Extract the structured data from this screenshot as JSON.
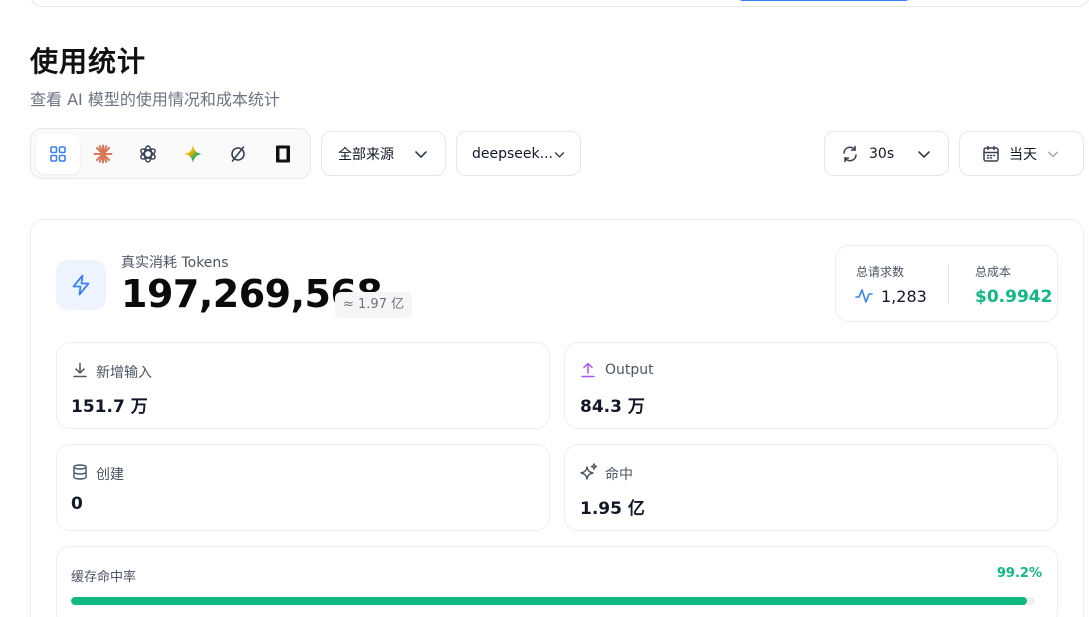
{
  "page": {
    "title": "使用统计",
    "subtitle": "查看 AI 模型的使用情况和成本统计"
  },
  "toolbar": {
    "providers": [
      {
        "icon": "grid-icon",
        "active": true
      },
      {
        "icon": "claude-icon",
        "active": false
      },
      {
        "icon": "openai-icon",
        "active": false
      },
      {
        "icon": "gemini-icon",
        "active": false
      },
      {
        "icon": "slash-circle-icon",
        "active": false
      },
      {
        "icon": "black-square-icon",
        "active": false
      }
    ],
    "source_select": "全部来源",
    "model_select": "deepseek...",
    "refresh_select": "30s",
    "date_select": "当天"
  },
  "tokens": {
    "label": "真实消耗 Tokens",
    "value": "197,269,568",
    "approx": "≈ 1.97 亿"
  },
  "summary": {
    "requests_label": "总请求数",
    "requests_value": "1,283",
    "cost_label": "总成本",
    "cost_value": "$0.9942"
  },
  "stats": {
    "input_label": "新增输入",
    "input_value": "151.7 万",
    "output_label": "Output",
    "output_value": "84.3 万",
    "create_label": "创建",
    "create_value": "0",
    "hit_label": "命中",
    "hit_value": "1.95 亿"
  },
  "cache": {
    "label": "缓存命中率",
    "percent_text": "99.2%",
    "percent": 99.2
  },
  "colors": {
    "accent_blue": "#3b82f6",
    "success_green": "#10b981",
    "output_purple": "#a855f7"
  }
}
